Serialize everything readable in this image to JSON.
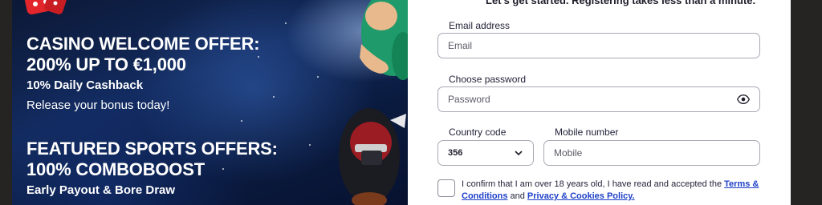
{
  "promo": {
    "casino_title_line1": "CASINO WELCOME OFFER:",
    "casino_title_line2": "200% UP TO €1,000",
    "casino_cashback": "10% Daily Cashback",
    "casino_release": "Release your bonus today!",
    "sports_title_line1": "FEATURED SPORTS OFFERS:",
    "sports_title_line2": "100% COMBOBOOST",
    "sports_early": "Early Payout & Bore Draw"
  },
  "form": {
    "intro": "Let's get started. Registering takes less than a minute.",
    "email_label": "Email address",
    "email_placeholder": "Email",
    "password_label": "Choose password",
    "password_placeholder": "Password",
    "country_label": "Country code",
    "country_value": "356",
    "mobile_label": "Mobile number",
    "mobile_placeholder": "Mobile",
    "consent_prefix": "I confirm that I am over 18 years old, I have read and accepted the ",
    "terms_link": "Terms & Conditions",
    "consent_and": " and ",
    "privacy_link": "Privacy & Cookies Policy."
  },
  "icons": {
    "password_toggle": "eye-icon",
    "country_dropdown": "chevron-down-icon",
    "dice": "dice-icon"
  },
  "colors": {
    "link": "#1d3fc7",
    "background_dark": "#262323",
    "promo_bg": "#0c1836"
  }
}
